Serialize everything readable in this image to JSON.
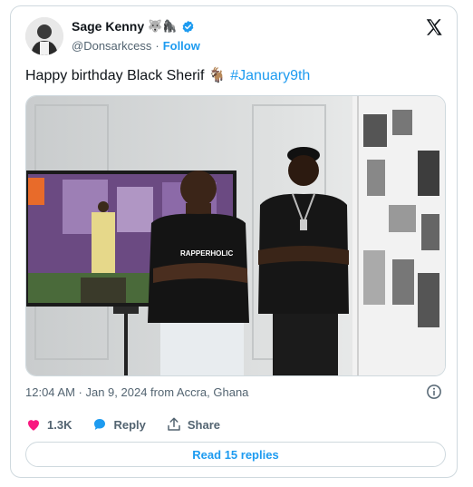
{
  "author": {
    "name": "Sage Kenny",
    "name_emojis": "🐺🦍",
    "handle": "@Donsarkcess",
    "separator": "·",
    "follow_label": "Follow"
  },
  "tweet": {
    "text": "Happy birthday Black Sherif 🐐",
    "hashtag": "#January9th",
    "shirt_text": "RAPPERHOLIC"
  },
  "meta": {
    "timestamp": "12:04 AM · Jan 9, 2024 from Accra, Ghana"
  },
  "actions": {
    "likes_count": "1.3K",
    "reply_label": "Reply",
    "share_label": "Share",
    "read_replies_label": "Read 15 replies"
  },
  "colors": {
    "accent": "#1d9bf0",
    "like": "#f91880",
    "text": "#0f1419",
    "muted": "#536471",
    "border": "#cfd9de"
  },
  "icons": {
    "verified": "verified-badge-icon",
    "x_logo": "x-logo-icon",
    "info": "info-icon",
    "like": "heart-icon",
    "reply": "reply-bubble-icon",
    "share": "share-upload-icon"
  }
}
